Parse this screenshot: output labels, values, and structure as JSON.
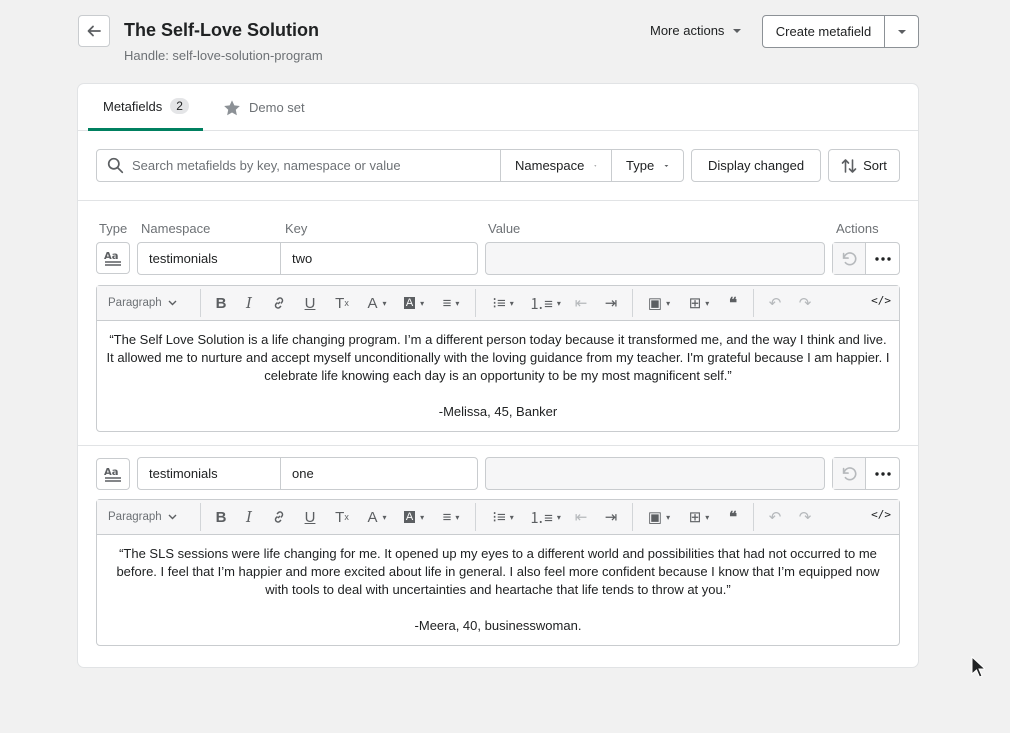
{
  "header": {
    "title": "The Self-Love Solution",
    "handle": "Handle: self-love-solution-program",
    "more_actions": "More actions",
    "create_metafield": "Create metafield"
  },
  "tabs": [
    {
      "label": "Metafields",
      "count": "2"
    },
    {
      "label": "Demo set"
    }
  ],
  "filters": {
    "search_placeholder": "Search metafields by key, namespace or value",
    "namespace": "Namespace",
    "type": "Type",
    "display_changed": "Display changed",
    "sort": "Sort"
  },
  "columns": {
    "type": "Type",
    "namespace": "Namespace",
    "key": "Key",
    "value": "Value",
    "actions": "Actions"
  },
  "toolbar": {
    "paragraph": "Paragraph"
  },
  "metafields": [
    {
      "namespace": "testimonials",
      "key": "two",
      "value": "",
      "content": [
        "“The Self Love Solution is a life changing program. I’m a different person today because it transformed me, and the way I think and live. It allowed me to nurture and accept myself unconditionally with the loving guidance from my teacher. I'm grateful because I am happier. I celebrate life knowing each day is an opportunity to be my most magnificent self.”",
        "-Melissa, 45, Banker"
      ]
    },
    {
      "namespace": "testimonials",
      "key": "one",
      "value": "",
      "content": [
        "“The SLS sessions were life changing for me. It opened up my eyes to a different world and possibilities that had not occurred to me before. I feel that I’m happier and more excited about life in general. I also feel more confident because I know that I’m equipped now with tools to deal with uncertainties and heartache that life tends to throw at you.”",
        "-Meera, 40, businesswoman."
      ]
    }
  ]
}
